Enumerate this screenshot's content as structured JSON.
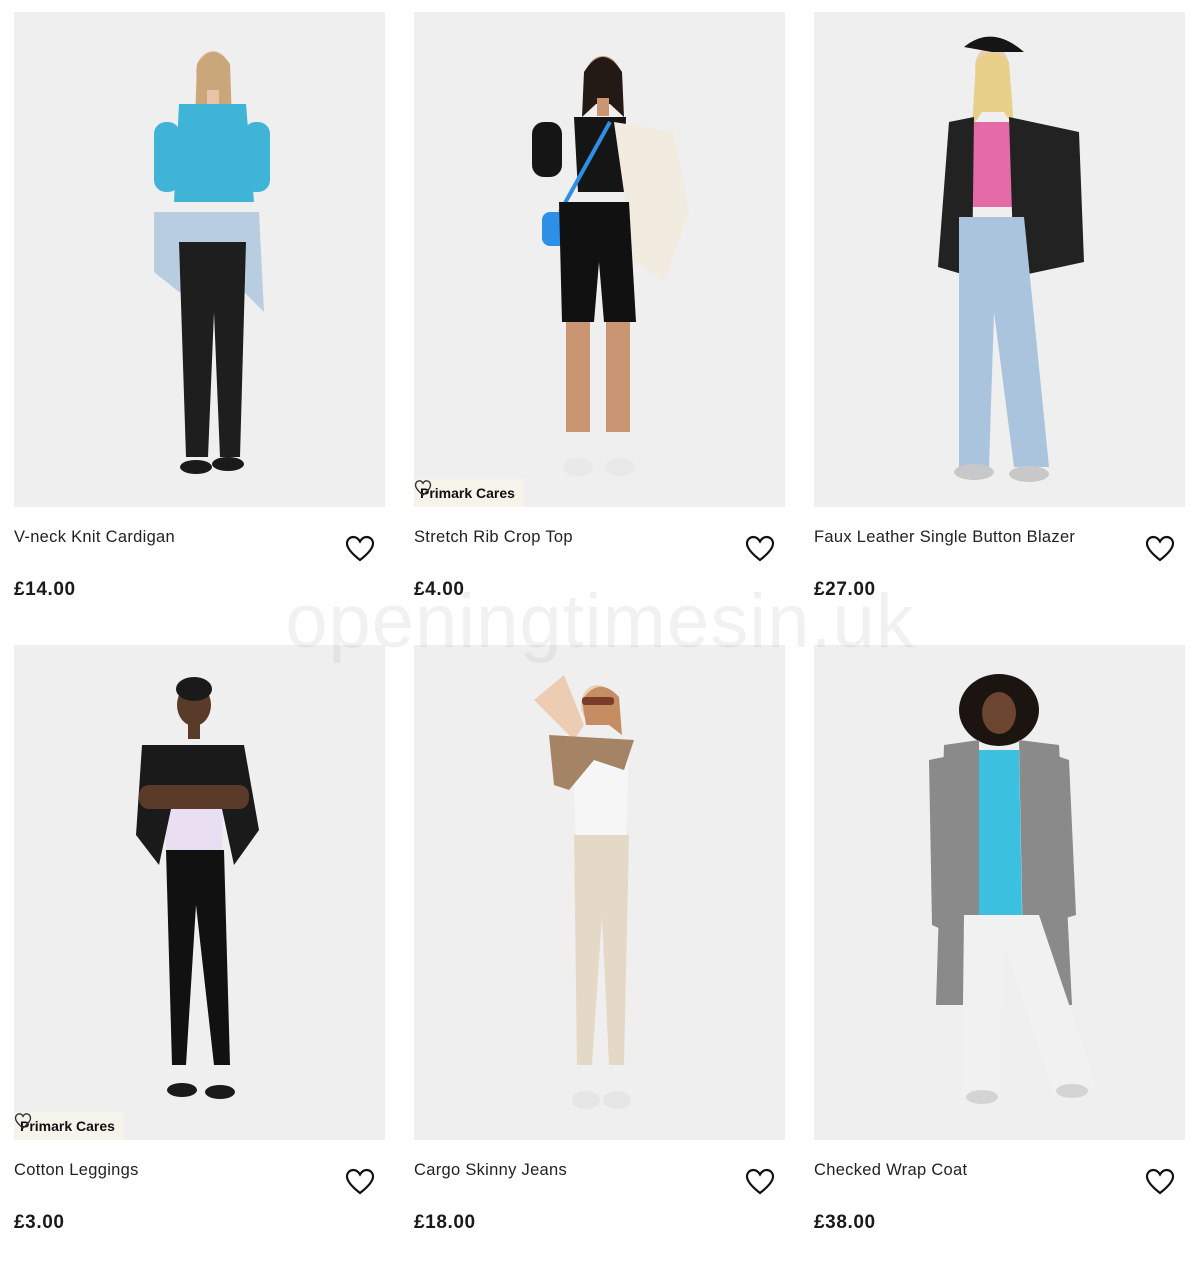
{
  "watermark": "openingtimesin.uk",
  "badge_label": "Primark Cares",
  "products": [
    {
      "name": "V-neck Knit Cardigan",
      "price": "£14.00",
      "badge": false,
      "top_color": "#3fb4d6",
      "bottom_color": "#1e1e1e",
      "extra_color": "#b9cde0"
    },
    {
      "name": "Stretch Rib Crop Top",
      "price": "£4.00",
      "badge": true,
      "top_color": "#151515",
      "bottom_color": "#111111",
      "extra_color": "#f2ece0"
    },
    {
      "name": "Faux Leather Single Button Blazer",
      "price": "£27.00",
      "badge": false,
      "top_color": "#e56aa8",
      "bottom_color": "#a9c4dc",
      "extra_color": "#222222"
    },
    {
      "name": "Cotton Leggings",
      "price": "£3.00",
      "badge": true,
      "top_color": "#e9dff0",
      "bottom_color": "#111111",
      "extra_color": "#1a1a1a"
    },
    {
      "name": "Cargo Skinny Jeans",
      "price": "£18.00",
      "badge": false,
      "top_color": "#f6f6f6",
      "bottom_color": "#e4d8c6",
      "extra_color": "#a48465"
    },
    {
      "name": "Checked Wrap Coat",
      "price": "£38.00",
      "badge": false,
      "top_color": "#3cc0e0",
      "bottom_color": "#f1f1f1",
      "extra_color": "#8a8a8a"
    }
  ]
}
